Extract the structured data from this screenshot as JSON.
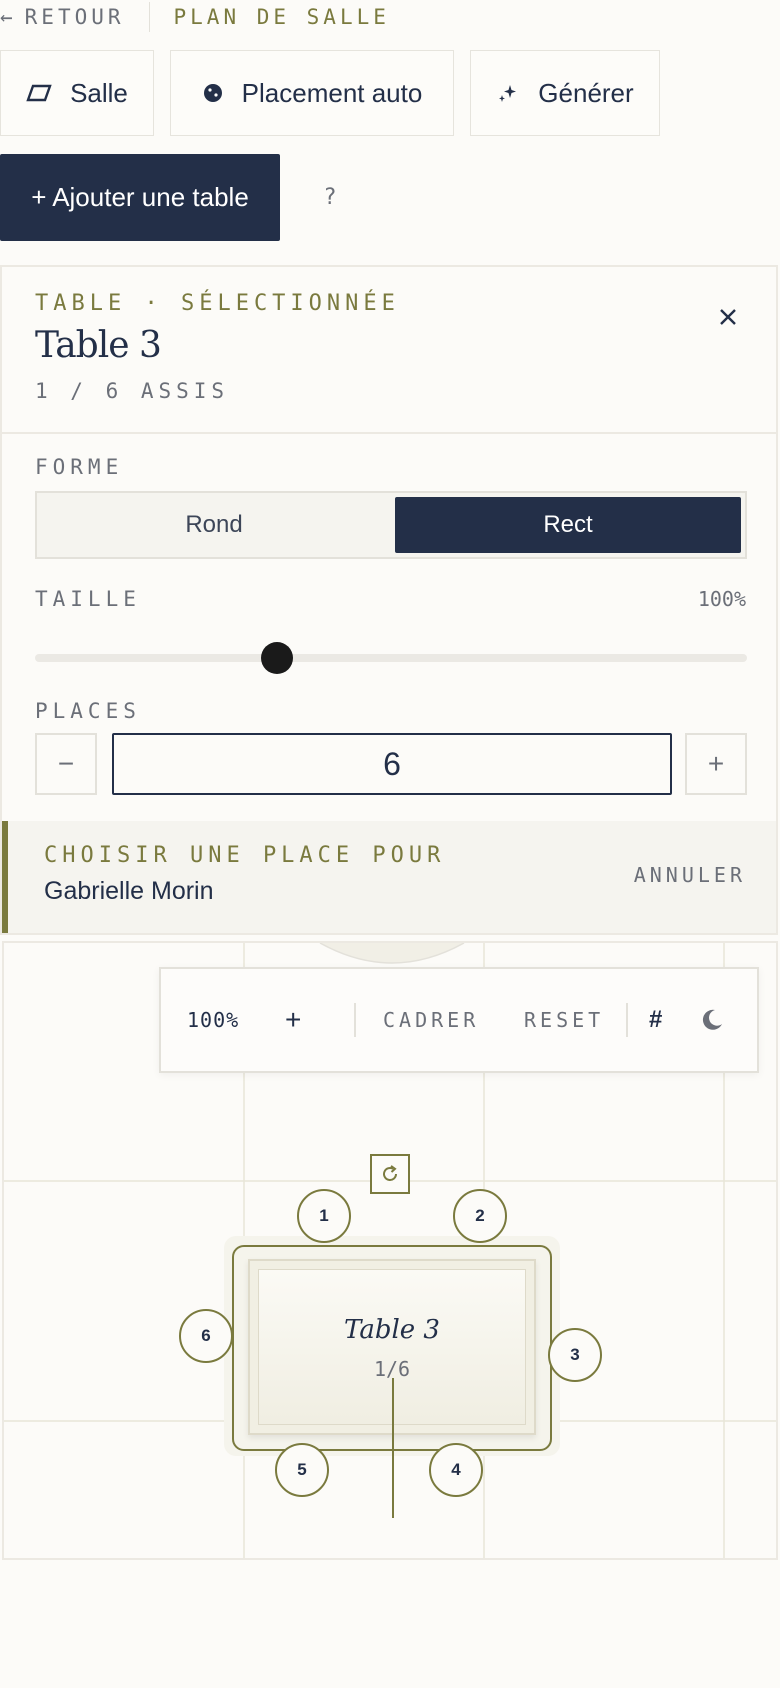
{
  "topbar": {
    "back_label": "RETOUR",
    "crumb": "PLAN DE SALLE"
  },
  "tools": {
    "salle": "Salle",
    "placement": "Placement auto",
    "generer": "Générer",
    "add_table": "+ Ajouter une table",
    "help": "?"
  },
  "panel": {
    "eyebrow": "TABLE · SÉLECTIONNÉE",
    "title": "Table 3",
    "seated": "1 / 6 ASSIS",
    "shape_label": "FORME",
    "shape_options": [
      "Rond",
      "Rect"
    ],
    "shape_selected": "Rect",
    "size_label": "TAILLE",
    "size_value": "100%",
    "size_fraction": 0.34,
    "places_label": "PLACES",
    "places_value": "6",
    "minus": "−",
    "plus": "+"
  },
  "pick": {
    "prompt": "CHOISIR UNE PLACE POUR",
    "guest": "Gabrielle Morin",
    "cancel": "ANNULER"
  },
  "canvas": {
    "zoom": "100%",
    "zoom_in": "+",
    "fit": "CADRER",
    "reset": "RESET",
    "grid_icon": "#",
    "table_name": "Table 3",
    "table_count": "1/6",
    "seats": [
      "1",
      "2",
      "3",
      "4",
      "5",
      "6"
    ]
  },
  "colors": {
    "navy": "#232f48",
    "olive": "#7a7a3e",
    "paper": "#fcfbf8"
  }
}
